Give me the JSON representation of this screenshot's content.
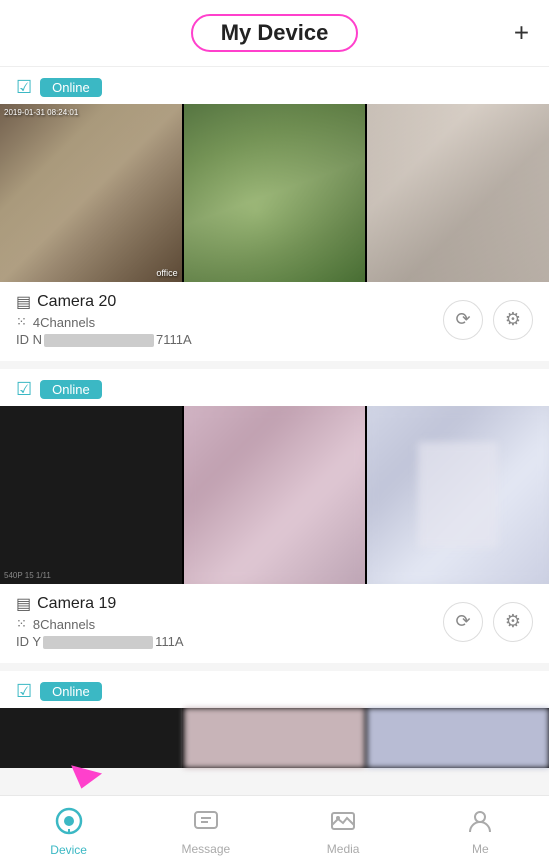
{
  "header": {
    "title": "My Device",
    "add_button": "+"
  },
  "devices": [
    {
      "status": "Online",
      "camera_name": "Camera 20",
      "channels": "4Channels",
      "id_prefix": "ID N",
      "id_suffix": "7111A",
      "thumbnails": [
        "cam-1",
        "cam-2",
        "cam-3"
      ],
      "timestamp": "2019-01-31 08:24:01",
      "cam_label": "office"
    },
    {
      "status": "Online",
      "camera_name": "Camera 19",
      "channels": "8Channels",
      "id_prefix": "ID Y",
      "id_suffix": "111A",
      "thumbnails": [
        "cam-black",
        "cam-blur-1",
        "cam-blur-2"
      ],
      "cam_label2": "540P 15 1/11"
    },
    {
      "status": "Online",
      "camera_name": "",
      "channels": "",
      "id_prefix": "",
      "id_suffix": "",
      "thumbnails": []
    }
  ],
  "bottom_nav": {
    "items": [
      {
        "label": "Device",
        "active": true
      },
      {
        "label": "Message",
        "active": false
      },
      {
        "label": "Media",
        "active": false
      },
      {
        "label": "Me",
        "active": false
      }
    ]
  }
}
